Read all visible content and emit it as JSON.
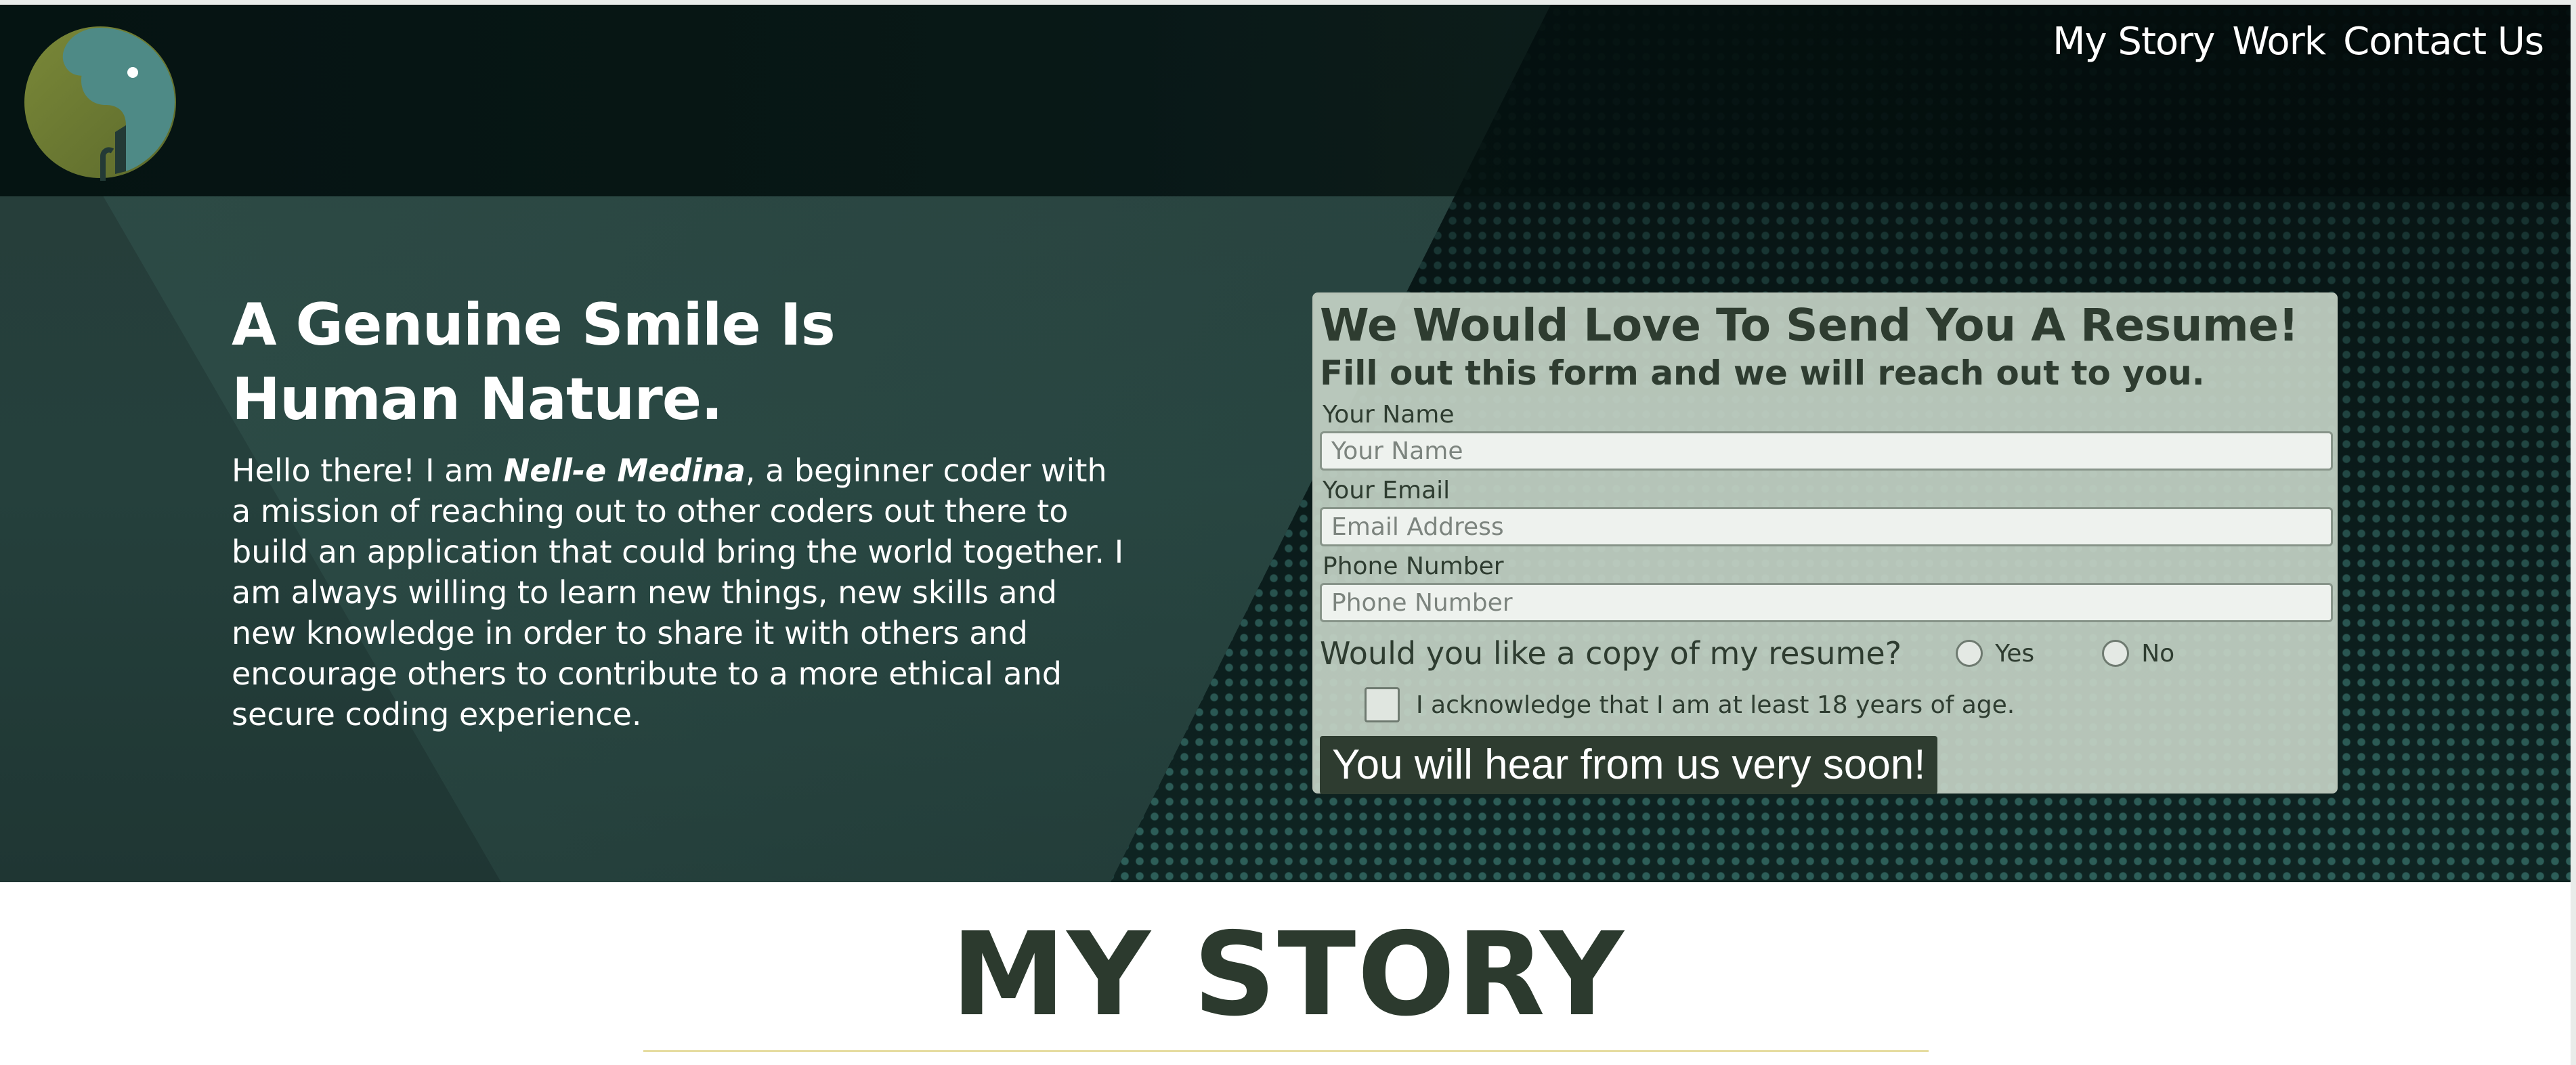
{
  "nav": {
    "items": [
      "My Story",
      "Work",
      "Contact Us"
    ]
  },
  "hero": {
    "title": "A Genuine Smile Is Human Nature.",
    "intro_before": "Hello there! I am ",
    "intro_name": "Nell-e Medina",
    "intro_after": ", a beginner coder with a mission of reaching out to other coders out there to build an application that could bring the world together. I am always willing to learn new things, new skills and new knowledge in order to share it with others and encourage others to contribute to a more ethical and secure coding experience."
  },
  "form": {
    "title": "We Would Love To Send You A Resume!",
    "subtitle": "Fill out this form and we will reach out to you.",
    "name_label": "Your Name",
    "name_placeholder": "Your Name",
    "email_label": "Your Email",
    "email_placeholder": "Email Address",
    "phone_label": "Phone Number",
    "phone_placeholder": "Phone Number",
    "resume_question": "Would you like a copy of my resume?",
    "yes_label": "Yes",
    "no_label": "No",
    "ack_label": "I acknowledge that I am at least 18 years of age.",
    "submit_label": "You will hear from us very soon!"
  },
  "story": {
    "heading": "MY STORY"
  },
  "colors": {
    "accent_dark_green": "#2e3c30",
    "hero_teal": "#25403c",
    "form_background": "#c4d2c6",
    "rule_gold": "#e6dca0",
    "logo_teal": "#4e8a86",
    "logo_olive": "#6e7a3a"
  },
  "icons": {
    "logo": "elephant-logo-icon"
  }
}
